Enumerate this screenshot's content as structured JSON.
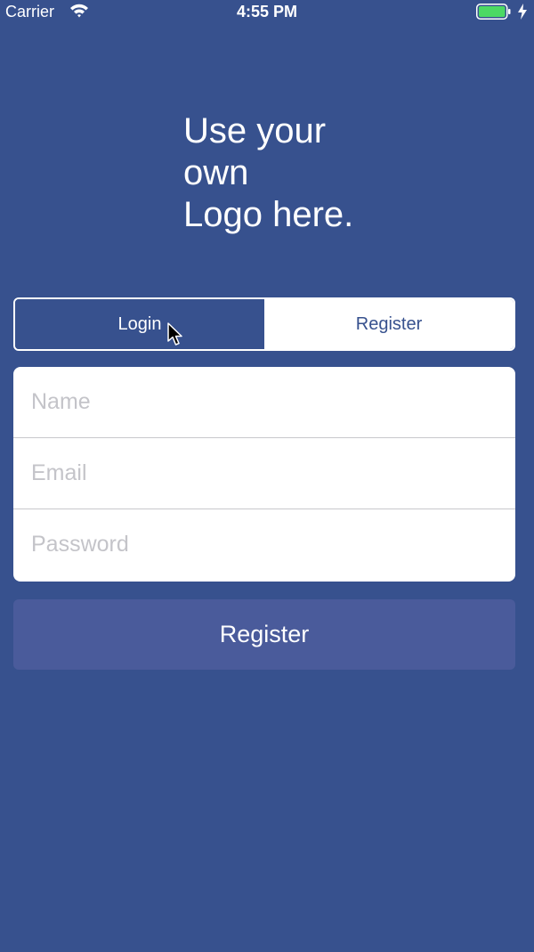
{
  "status_bar": {
    "carrier": "Carrier",
    "time": "4:55 PM",
    "wifi_icon": "wifi-icon",
    "battery_icon": "battery-icon",
    "battery_color": "#4cd964"
  },
  "logo": {
    "text": "Use your\nown\nLogo here."
  },
  "segmented_control": {
    "login_label": "Login",
    "register_label": "Register",
    "selected": "Login"
  },
  "form": {
    "name_placeholder": "Name",
    "email_placeholder": "Email",
    "password_placeholder": "Password"
  },
  "submit": {
    "label": "Register"
  },
  "colors": {
    "background": "#37518e",
    "button": "#4a5b9b",
    "card": "#ffffff"
  }
}
